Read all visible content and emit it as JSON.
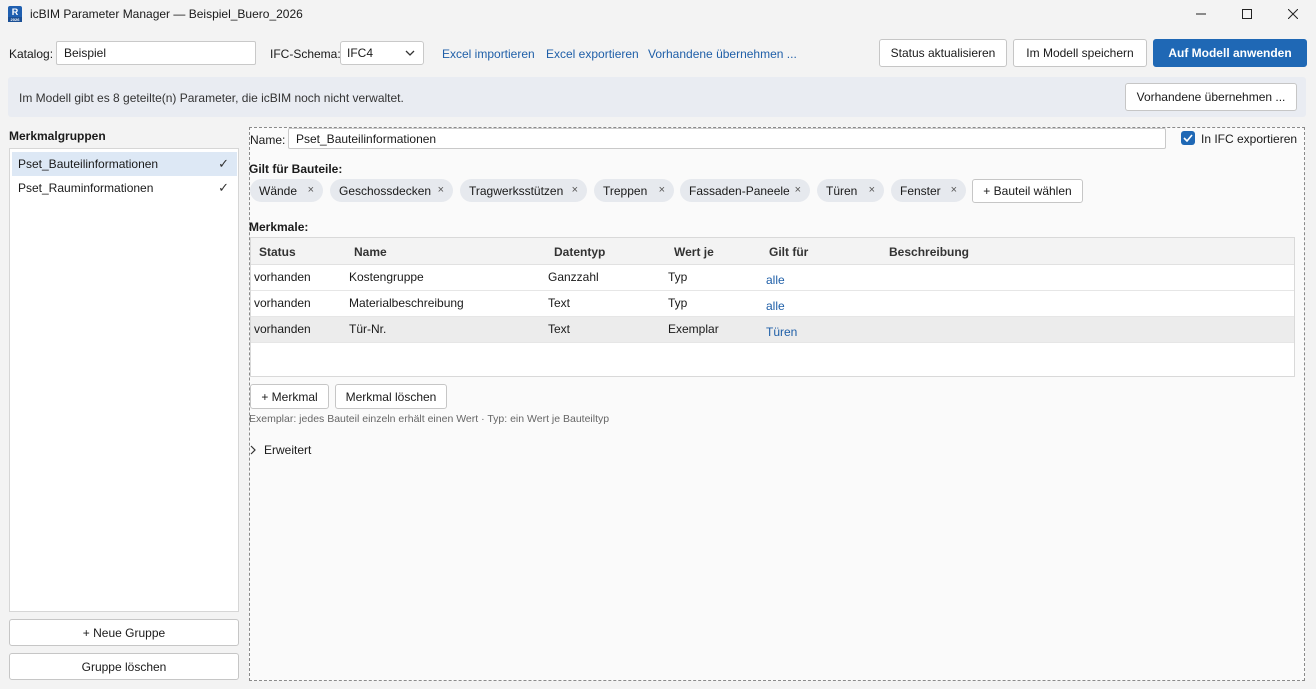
{
  "window": {
    "title": "icBIM Parameter Manager — Beispiel_Buero_2026",
    "icon_letter": "R",
    "icon_sub": "2026"
  },
  "toolbar": {
    "katalog_label": "Katalog:",
    "katalog_value": "Beispiel",
    "schema_label": "IFC-Schema:",
    "schema_value": "IFC4",
    "link_import": "Excel importieren",
    "link_export": "Excel exportieren",
    "link_adopt": "Vorhandene übernehmen ...",
    "btn_status": "Status aktualisieren",
    "btn_save": "Im Modell speichern",
    "btn_apply": "Auf Modell anwenden"
  },
  "info": {
    "message": "Im Modell gibt es 8 geteilte(n) Parameter, die icBIM noch nicht verwaltet.",
    "button": "Vorhandene übernehmen ..."
  },
  "groups": {
    "title": "Merkmalgruppen",
    "items": [
      {
        "label": "Pset_Bauteilinformationen",
        "check": "✓"
      },
      {
        "label": "Pset_Rauminformationen",
        "check": "✓"
      }
    ],
    "add_button": "+ Neue Gruppe",
    "delete_button": "Gruppe löschen"
  },
  "editor": {
    "name_label": "Name:",
    "name_value": "Pset_Bauteilinformationen",
    "ifc_export_label": "In IFC exportieren",
    "applies_title": "Gilt für Bauteile:",
    "chips": [
      "Wände",
      "Geschossdecken",
      "Tragwerksstützen",
      "Treppen",
      "Fassaden-Paneele",
      "Türen",
      "Fenster"
    ],
    "chip_remove": "×",
    "add_component": "+ Bauteil wählen",
    "props_title": "Merkmale:",
    "columns": [
      "Status",
      "Name",
      "Datentyp",
      "Wert je",
      "Gilt für",
      "Beschreibung"
    ],
    "rows": [
      {
        "status": "vorhanden",
        "name": "Kostengruppe",
        "datatype": "Ganzzahl",
        "per": "Typ",
        "applies": "alle",
        "desc": ""
      },
      {
        "status": "vorhanden",
        "name": "Materialbeschreibung",
        "datatype": "Text",
        "per": "Typ",
        "applies": "alle",
        "desc": ""
      },
      {
        "status": "vorhanden",
        "name": "Tür-Nr.",
        "datatype": "Text",
        "per": "Exemplar",
        "applies": "Türen",
        "desc": ""
      }
    ],
    "add_prop": "+ Merkmal",
    "delete_prop": "Merkmal löschen",
    "hint": "Exemplar: jedes Bauteil einzeln erhält einen Wert · Typ: ein Wert je Bauteiltyp",
    "advanced": "Erweitert"
  },
  "colors": {
    "accent": "#1f68b5",
    "link": "#1f5fa8",
    "selection": "#dde8f5"
  }
}
